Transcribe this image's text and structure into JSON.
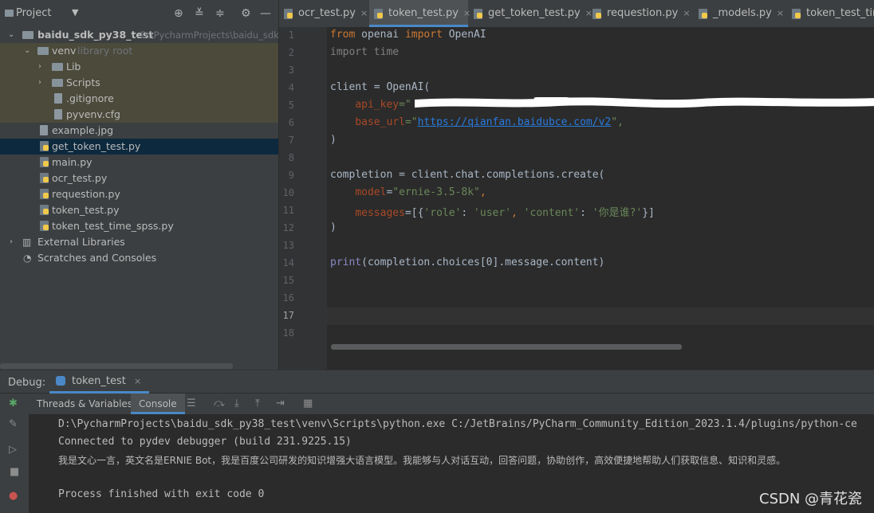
{
  "project_panel": {
    "title": "Project",
    "dropdown": "▼",
    "header_icons": [
      "⊕",
      "≚",
      "≑",
      "⚙",
      "—"
    ],
    "tree": [
      {
        "label": "baidu_sdk_py38_test",
        "suffix": "D:\\PycharmProjects\\baidu_sdk",
        "bold": true
      },
      {
        "label": "venv",
        "suffix": "library root"
      },
      {
        "label": "Lib"
      },
      {
        "label": "Scripts"
      },
      {
        "label": ".gitignore"
      },
      {
        "label": "pyvenv.cfg"
      },
      {
        "label": "example.jpg"
      },
      {
        "label": "get_token_test.py"
      },
      {
        "label": "main.py"
      },
      {
        "label": "ocr_test.py"
      },
      {
        "label": "requestion.py"
      },
      {
        "label": "token_test.py"
      },
      {
        "label": "token_test_time_spss.py"
      },
      {
        "label": "External Libraries"
      },
      {
        "label": "Scratches and Consoles"
      }
    ]
  },
  "editor_tabs": [
    {
      "label": "ocr_test.py"
    },
    {
      "label": "token_test.py",
      "active": true
    },
    {
      "label": "get_token_test.py"
    },
    {
      "label": "requestion.py"
    },
    {
      "label": "_models.py"
    },
    {
      "label": "token_test_time"
    }
  ],
  "tab_close": "×",
  "editor": {
    "line_numbers": [
      "1",
      "2",
      "3",
      "4",
      "5",
      "6",
      "7",
      "8",
      "9",
      "10",
      "11",
      "12",
      "13",
      "14",
      "15",
      "16",
      "17",
      "18"
    ],
    "lines": {
      "l1_from": "from",
      "l1_mod": " openai ",
      "l1_import": "import",
      "l1_name": " OpenAI",
      "l2_import": "import",
      "l2_name": " time",
      "l4": "client = OpenAI(",
      "l5_param": "api_key",
      "l5_rest": "=\"",
      "l6_param": "base_url",
      "l6_eq": "=\"",
      "l6_url": "https://qianfan.baidubce.com/v2",
      "l6_end": "\",",
      "l7": ")",
      "l9": "completion = client.chat.completions.create(",
      "l10_param": "model",
      "l10_eq": "=",
      "l10_str": "\"ernie-3.5-8k\"",
      "l10_end": ",",
      "l11_param": "messages",
      "l11_a": "=[{",
      "l11_s1": "'role'",
      "l11_b": ": ",
      "l11_s2": "'user'",
      "l11_c": ", ",
      "l11_s3": "'content'",
      "l11_d": ": ",
      "l11_s4": "'你是谁?'",
      "l11_e": "}]",
      "l12": ")",
      "l14_fn": "print",
      "l14_rest": "(completion.choices[0].message.content)"
    }
  },
  "debug": {
    "label": "Debug:",
    "tab": "token_test",
    "subtabs": [
      "Threads & Variables",
      "Console"
    ],
    "console_lines": [
      "D:\\PycharmProjects\\baidu_sdk_py38_test\\venv\\Scripts\\python.exe C:/JetBrains/PyCharm_Community_Edition_2023.1.4/plugins/python-ce",
      "Connected to pydev debugger (build 231.9225.15)",
      "我是文心一言，英文名是ERNIE Bot，我是百度公司研发的知识增强大语言模型。我能够与人对话互动，回答问题，协助创作，高效便捷地帮助人们获取信息、知识和灵感。",
      "",
      "Process finished with exit code 0"
    ]
  },
  "watermark": "CSDN @青花瓷",
  "colors": {
    "accent": "#4a88c7",
    "selection": "#0d293e",
    "keyword": "#cc7832",
    "string": "#6a8759"
  }
}
